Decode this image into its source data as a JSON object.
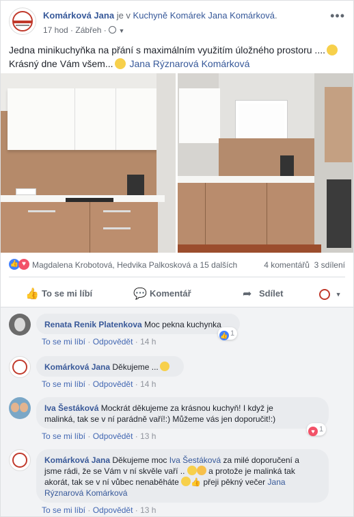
{
  "post": {
    "author": "Komárková Jana",
    "connector": "je v",
    "place": "Kuchyně Komárek Jana Komárková",
    "period": ".",
    "time": "17 hod",
    "separator": "·",
    "location": "Zábřeh",
    "more_icon": "•••",
    "text_line1": "Jedna minikuchyňka na přání s maximálním využitím úložného prostoru ....",
    "text_line2": "Krásný dne Vám všem...",
    "tagged": "Jana Rýznarová Komárková"
  },
  "stats": {
    "reactors": "Magdalena Krobotová, Hedvika Palkosková a 15 dalších",
    "comments": "4 komentářů",
    "shares": "3 sdílení"
  },
  "actions": {
    "like": "To se mi líbí",
    "comment": "Komentář",
    "share": "Sdílet"
  },
  "comments": [
    {
      "name": "Renata Renik Platenkova",
      "text": "Moc pekna kuchynka",
      "like": "To se mi líbí",
      "reply": "Odpovědět",
      "time": "14 h",
      "reactions": "1"
    },
    {
      "name": "Komárková Jana",
      "text": "Děkujeme ...",
      "like": "To se mi líbí",
      "reply": "Odpovědět",
      "time": "14 h"
    },
    {
      "name": "Iva Šestáková",
      "text1": "Mockrát děkujeme za krásnou kuchyň! I když je",
      "text2": "malinká, tak se v ní parádně vaří!:) Můžeme vás jen doporučit!:)",
      "like": "To se mi líbí",
      "reply": "Odpovědět",
      "time": "13 h",
      "reactions": "1"
    },
    {
      "name": "Komárková Jana",
      "text1a": "Děkujeme moc",
      "mention": "Iva Šestáková",
      "text1b": "za milé doporučení a",
      "text2a": "jsme rádi, že se Vám v ní skvěle vaří ..",
      "text2b": "a protože je malinká tak",
      "text3a": "akorát, tak se v ní vůbec nenaběháte",
      "text3b": "přeji pěkný večer",
      "mention2a": "Jana",
      "mention2b": "Rýznarová Komárková",
      "like": "To se mi líbí",
      "reply": "Odpovědět",
      "time": "13 h"
    }
  ],
  "meta_sep": "·",
  "colors": {
    "link": "#365899",
    "like_blue": "#4080ff",
    "love_red": "#f25268",
    "muted": "#90949c"
  }
}
